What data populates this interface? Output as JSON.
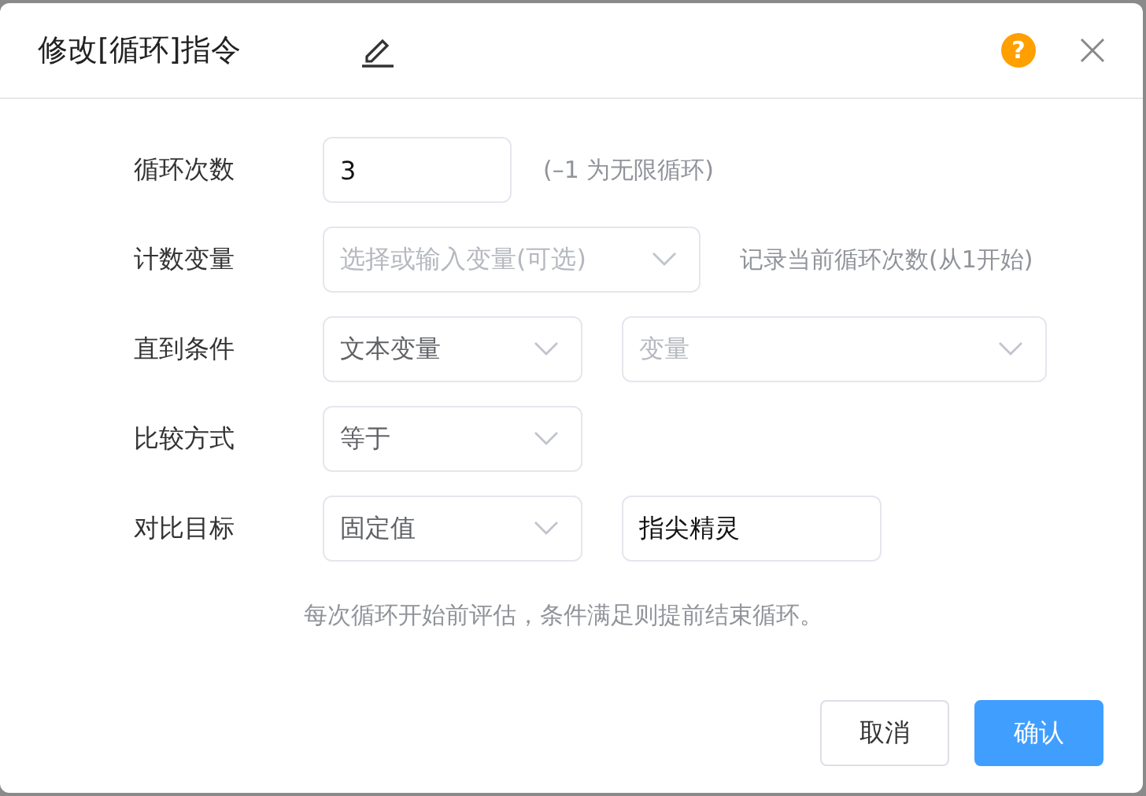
{
  "dialog": {
    "title": "修改[循环]指令",
    "help_icon": "?"
  },
  "rows": [
    {
      "label": "循环次数",
      "controls": [
        {
          "kind": "input",
          "value": "3"
        }
      ],
      "note": "(–1 为无限循环)"
    },
    {
      "label": "计数变量",
      "controls": [
        {
          "kind": "select",
          "placeholder": "选择或输入变量(可选)"
        }
      ],
      "note": "记录当前循环次数(从1开始)"
    },
    {
      "label": "直到条件",
      "controls": [
        {
          "kind": "select",
          "value": "文本变量"
        },
        {
          "kind": "select",
          "placeholder": "变量"
        }
      ]
    },
    {
      "label": "比较方式",
      "controls": [
        {
          "kind": "select",
          "value": "等于"
        }
      ]
    },
    {
      "label": "对比目标",
      "controls": [
        {
          "kind": "select",
          "value": "固定值"
        },
        {
          "kind": "input",
          "value": "指尖精灵"
        }
      ]
    }
  ],
  "hint": "每次循环开始前评估，条件满足则提前结束循环。",
  "buttons": [
    {
      "label": "取消",
      "kind": "secondary"
    },
    {
      "label": "确认",
      "kind": "primary"
    }
  ]
}
